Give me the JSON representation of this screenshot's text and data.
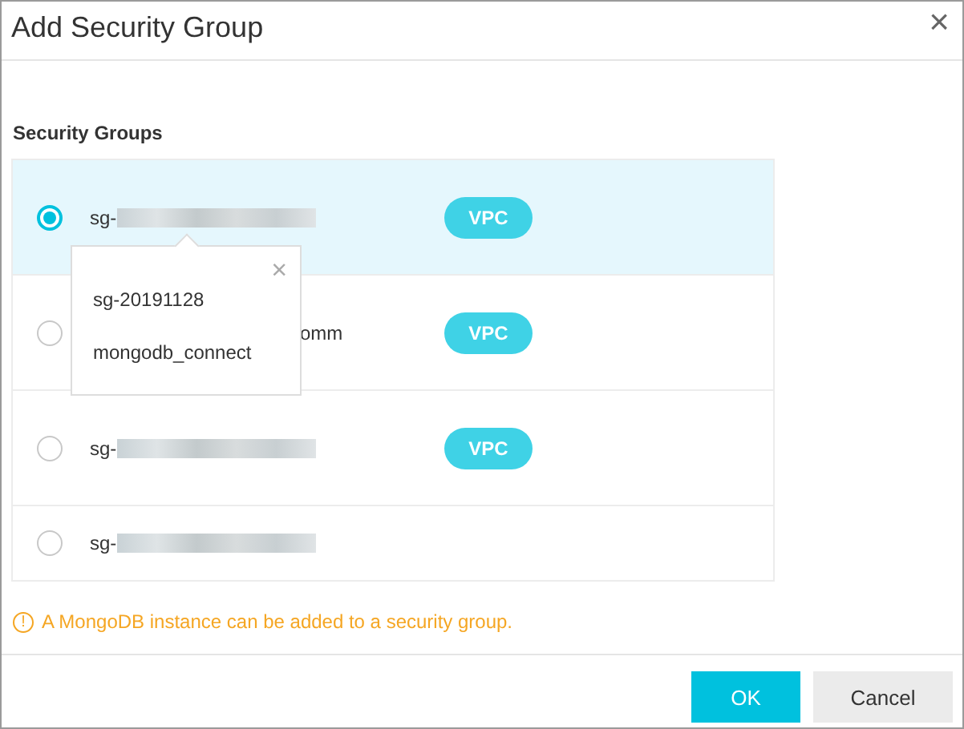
{
  "window": {
    "title": "Add Security Group",
    "close": "×"
  },
  "section_label": "Security Groups",
  "rows": [
    {
      "name": "sg-",
      "redacted": true,
      "selected": true,
      "tag": "VPC"
    },
    {
      "name": "omm",
      "redacted": false,
      "selected": false,
      "tag": "VPC"
    },
    {
      "name": "sg-",
      "redacted": true,
      "selected": false,
      "tag": "VPC"
    },
    {
      "name": "sg-",
      "redacted": true,
      "selected": false
    }
  ],
  "popover": {
    "close": "×",
    "lines": [
      "sg-20191128",
      "mongodb_connect"
    ]
  },
  "notice": {
    "icon": "!",
    "text": "A MongoDB instance can be added to a security group."
  },
  "buttons": [
    {
      "label": "OK",
      "kind": "primary"
    },
    {
      "label": "Cancel",
      "kind": "secondary"
    }
  ]
}
